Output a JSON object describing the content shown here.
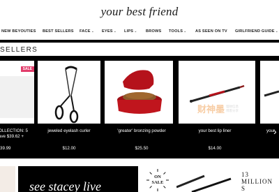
{
  "header": {
    "logo_text": "your best friend"
  },
  "nav": {
    "items": [
      {
        "label": "NEW BEYOUTIES",
        "dropdown": false
      },
      {
        "label": "BEST SELLERS",
        "dropdown": false
      },
      {
        "label": "FACE",
        "dropdown": true
      },
      {
        "label": "EYES",
        "dropdown": true
      },
      {
        "label": "LIPS",
        "dropdown": true
      },
      {
        "label": "BROWS",
        "dropdown": false
      },
      {
        "label": "TOOLS",
        "dropdown": true
      },
      {
        "label": "AS SEEN ON TV",
        "dropdown": false
      },
      {
        "label": "GIRLFRIEND GUIDE",
        "dropdown": true
      }
    ]
  },
  "section": {
    "title": "SELLERS"
  },
  "products": [
    {
      "name": "OLLECTION: 5 ave $39.62 +",
      "price": "39.99",
      "badge": "SALE"
    },
    {
      "name": "jeweled eyelash curler",
      "price": "$12.00"
    },
    {
      "name": "'greater' bronzing powder",
      "price": "$25.50"
    },
    {
      "name": "your best lip liner",
      "price": "$14.00"
    },
    {
      "name": "your",
      "price": ""
    }
  ],
  "carousel": {
    "next_arrow": "›"
  },
  "promo": {
    "left_text": "see stacey live",
    "right_headline": "13 MILLION S",
    "on_sale_line1": "ON",
    "on_sale_line2": "SALE"
  },
  "watermark": {
    "main": "财神墨",
    "sub_line1": "理财信息",
    "sub_line2": "博客分享"
  },
  "colors": {
    "accent": "#e23d6b",
    "bronze_case": "#c0151d",
    "background": "#ffffff",
    "carousel_bg": "#000000"
  }
}
